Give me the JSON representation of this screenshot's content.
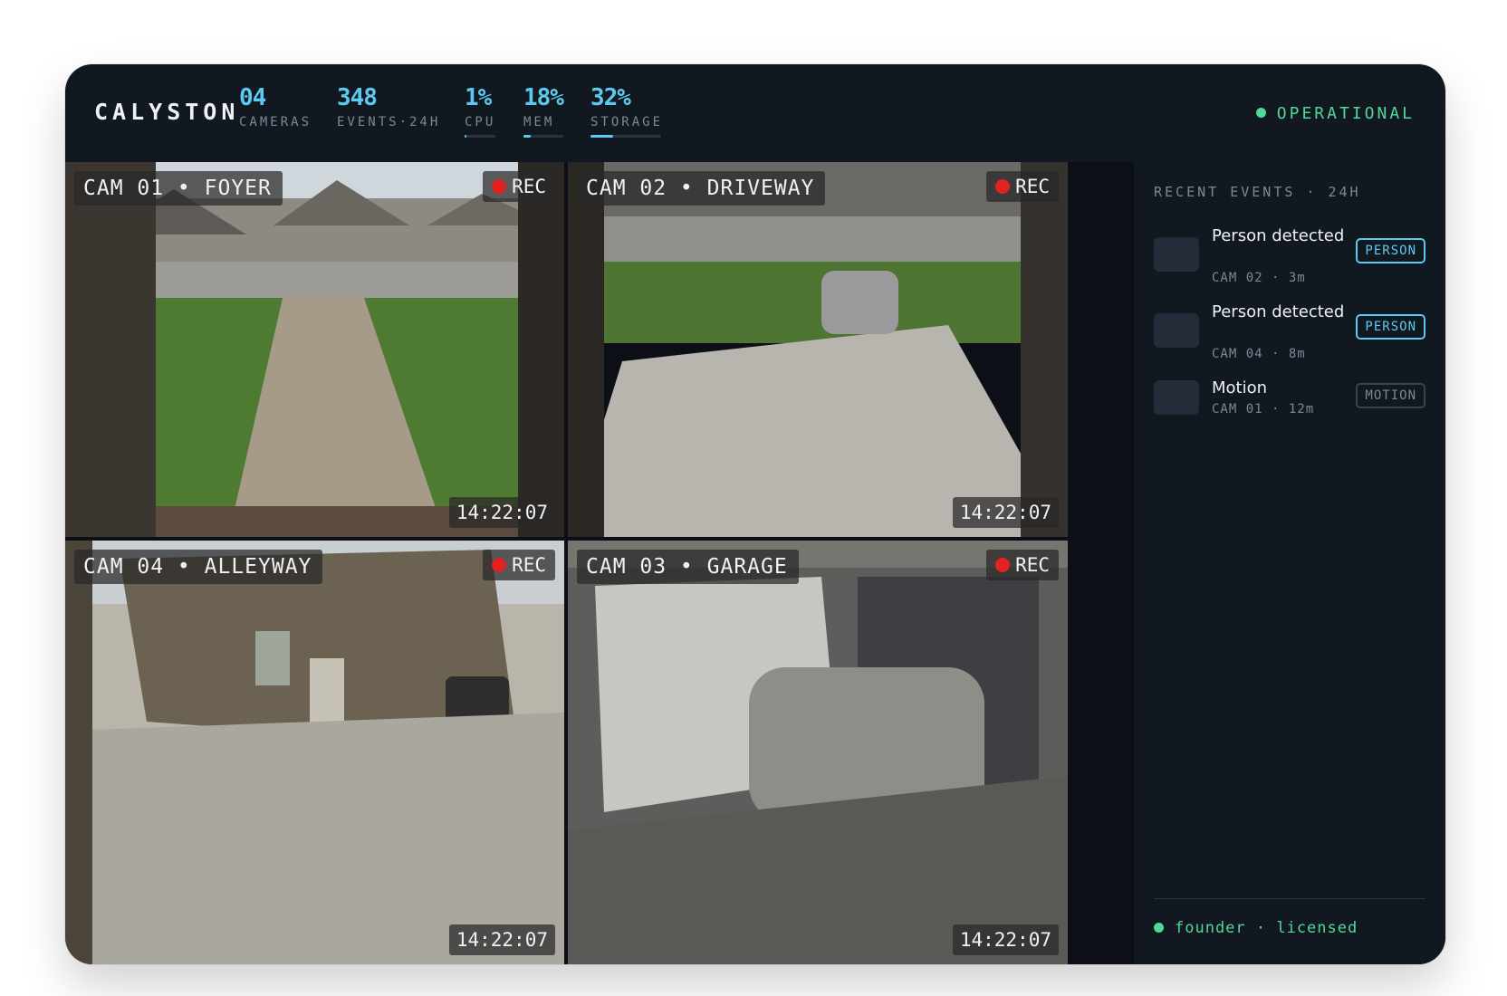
{
  "app": {
    "brand": "CALYSTON"
  },
  "stats": [
    {
      "value": "04",
      "label": "CAMERAS"
    },
    {
      "value": "348",
      "label": "EVENTS·24H"
    },
    {
      "value": "1%",
      "label": "CPU",
      "level": 0.01
    },
    {
      "value": "18%",
      "label": "MEM",
      "level": 0.18
    },
    {
      "value": "32%",
      "label": "STORAGE",
      "level": 0.32
    }
  ],
  "status": {
    "label": "OPERATIONAL",
    "color": "#4fd89a"
  },
  "cameras": [
    {
      "label": "CAM 01 • FOYER",
      "rec": "REC",
      "time": "14:22:07"
    },
    {
      "label": "CAM 02 • DRIVEWAY",
      "rec": "REC",
      "time": "14:22:07"
    },
    {
      "label": "CAM 04 • ALLEYWAY",
      "rec": "REC",
      "time": "14:22:07"
    },
    {
      "label": "CAM 03 • GARAGE",
      "rec": "REC",
      "time": "14:22:07"
    }
  ],
  "events_panel": {
    "title": "RECENT EVENTS · 24H",
    "events": [
      {
        "title": "Person detected",
        "meta": "CAM 02 · 3m",
        "tag": "PERSON"
      },
      {
        "title": "Person detected",
        "meta": "CAM 04 · 8m",
        "tag": "PERSON"
      },
      {
        "title": "Motion",
        "meta": "CAM 01 · 12m",
        "tag": "MOTION"
      }
    ],
    "footer": "founder · licensed"
  },
  "colors": {
    "accent": "#5ccaf0",
    "ok": "#4fd89a",
    "rec": "#e22222",
    "bg": "#121820"
  }
}
